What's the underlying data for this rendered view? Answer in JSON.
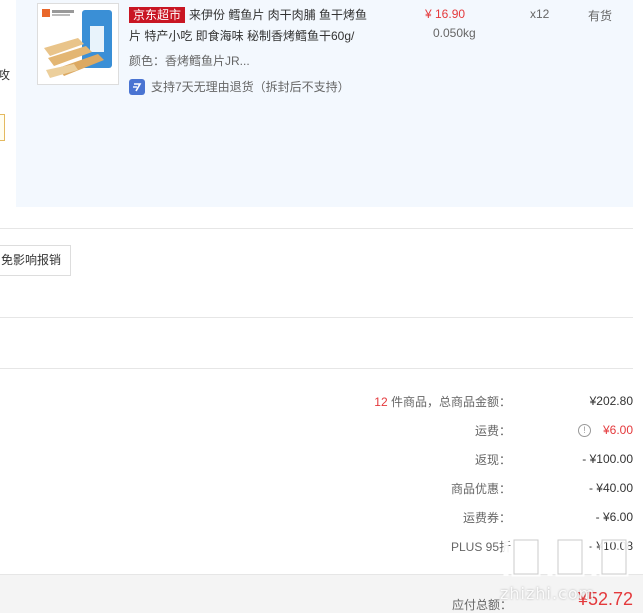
{
  "product": {
    "tag": "京东超市",
    "title": "来伊份 鳕鱼片 肉干肉脯 鱼干烤鱼片 特产小吃 即食海味 秘制香烤鳕鱼干60g/",
    "color": "颜色：香烤鳕鱼片JR...",
    "return_policy": "支持7天无理由退货（拆封后不支持）",
    "price": "¥ 16.90",
    "weight": "0.050kg",
    "quantity": "x12",
    "stock": "有货",
    "thumb_brand": "来伊份"
  },
  "left_edge": {
    "text": "攻"
  },
  "invoice": {
    "button_label": "免影响报销"
  },
  "summary": {
    "count": "12",
    "count_label": "件商品，总商品金额：",
    "total_goods": "¥202.80",
    "shipping_label": "运费：",
    "shipping_value": "¥6.00",
    "cashback_label": "返现：",
    "cashback_value": "- ¥100.00",
    "discount_label": "商品优惠：",
    "discount_value": "- ¥40.00",
    "coupon_label": "运费券：",
    "coupon_value": "- ¥6.00",
    "plus_label": "PLUS 95折",
    "plus_value": "- ¥10.08"
  },
  "footer": {
    "total_label": "应付总额：",
    "total_value": "¥52.72"
  },
  "watermark": {
    "text": "zhizhi.com"
  },
  "colors": {
    "accent_red": "#e4393c",
    "tag_red": "#c91623",
    "item_bg": "#f3f8fe",
    "return_icon_blue": "#4a74d2"
  }
}
